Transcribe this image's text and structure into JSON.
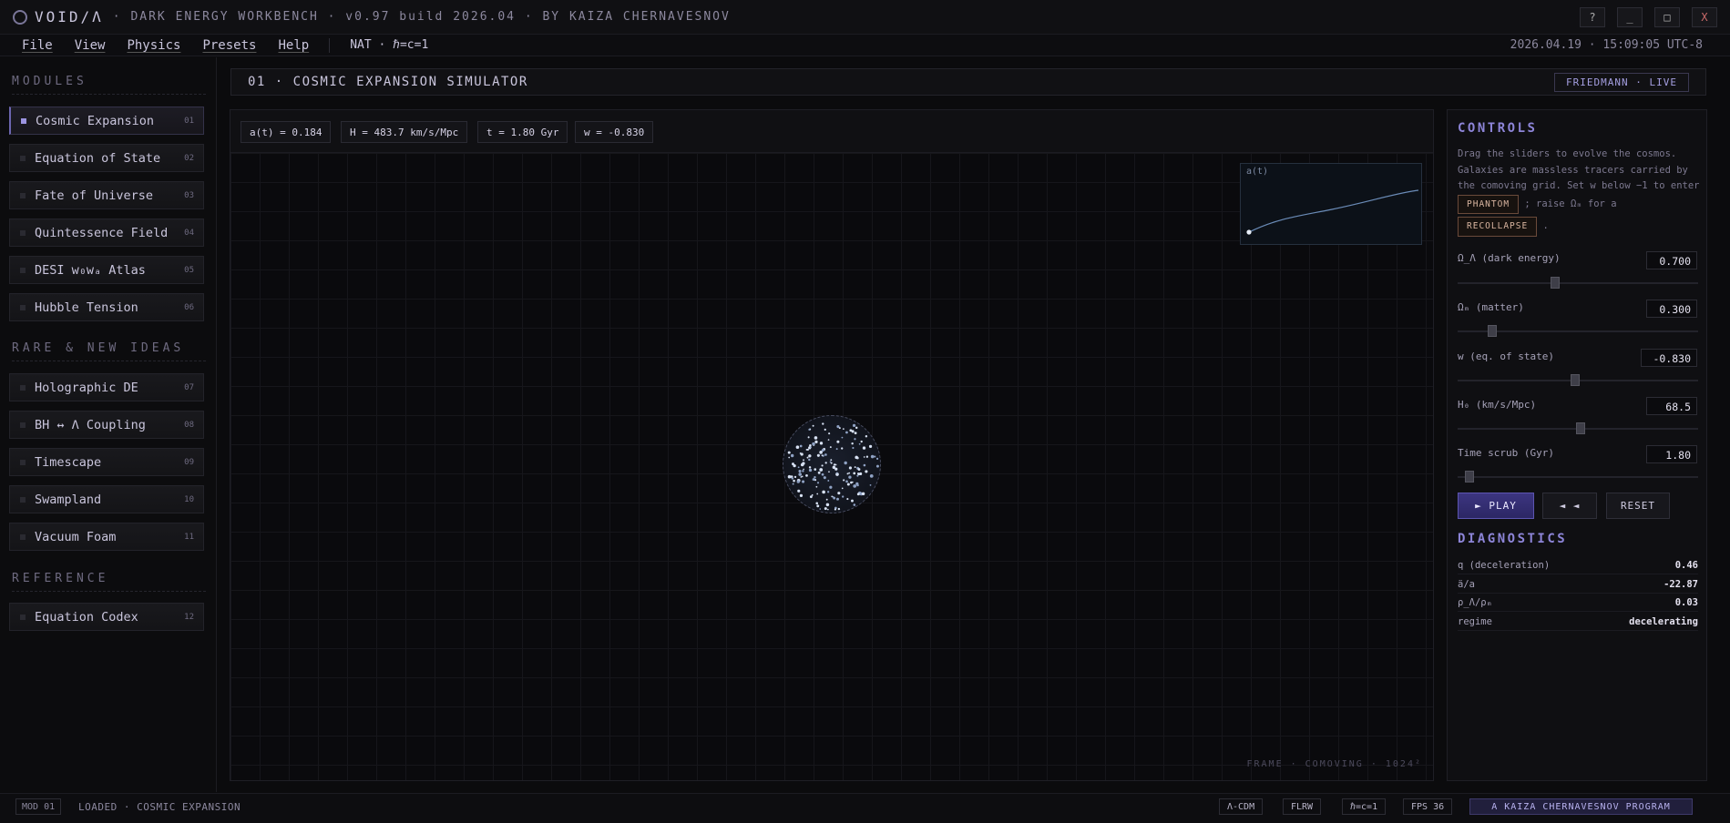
{
  "titlebar": {
    "app_name": "VOID/Λ",
    "subtitle": "· DARK ENERGY WORKBENCH · v0.97 build 2026.04 · BY KAIZA CHERNAVESNOV",
    "buttons": {
      "help": "?",
      "minimize": "_",
      "maximize": "□",
      "close": "X"
    }
  },
  "menubar": {
    "items": [
      "File",
      "View",
      "Physics",
      "Presets",
      "Help"
    ],
    "units": "NAT · ℏ=c=1",
    "clock": "2026.04.19 · 15:09:05 UTC-8"
  },
  "sidebar": {
    "sections": [
      {
        "title": "MODULES",
        "items": [
          {
            "label": "Cosmic Expansion",
            "num": "01",
            "active": true
          },
          {
            "label": "Equation of State",
            "num": "02"
          },
          {
            "label": "Fate of Universe",
            "num": "03"
          },
          {
            "label": "Quintessence Field",
            "num": "04"
          },
          {
            "label": "DESI w₀wₐ Atlas",
            "num": "05"
          },
          {
            "label": "Hubble Tension",
            "num": "06"
          }
        ]
      },
      {
        "title": "RARE & NEW IDEAS",
        "items": [
          {
            "label": "Holographic DE",
            "num": "07"
          },
          {
            "label": "BH ↔ Λ Coupling",
            "num": "08"
          },
          {
            "label": "Timescape",
            "num": "09"
          },
          {
            "label": "Swampland",
            "num": "10"
          },
          {
            "label": "Vacuum Foam",
            "num": "11"
          }
        ]
      },
      {
        "title": "REFERENCE",
        "items": [
          {
            "label": "Equation Codex",
            "num": "12"
          }
        ]
      }
    ]
  },
  "main": {
    "title": "01 · COSMIC EXPANSION SIMULATOR",
    "badge": "FRIEDMANN · LIVE",
    "readouts": {
      "a": "a(t) = 0.184",
      "H": "H = 483.7 km/s/Mpc",
      "t": "t = 1.80 Gyr",
      "w": "w = -0.830"
    },
    "minichart_label": "a(t)",
    "footer": "FRAME · COMOVING · 1024²"
  },
  "controls": {
    "title": "CONTROLS",
    "desc_1": "Drag the sliders to evolve the cosmos. Galaxies are massless tracers carried by the comoving grid. Set w below −1 to enter",
    "phantom_btn": "PHANTOM",
    "desc_2": "; raise Ωₘ for a",
    "recollapse_btn": "RECOLLAPSE",
    "desc_3": ".",
    "params": [
      {
        "label": "Ω_Λ (dark energy)",
        "value": "0.700",
        "fraction": 0.4
      },
      {
        "label": "Ωₘ (matter)",
        "value": "0.300",
        "fraction": 0.13
      },
      {
        "label": "w (eq. of state)",
        "value": "-0.830",
        "fraction": 0.49
      },
      {
        "label": "H₀ (km/s/Mpc)",
        "value": "68.5",
        "fraction": 0.51
      },
      {
        "label": "Time scrub (Gyr)",
        "value": "1.80",
        "fraction": 0.03
      }
    ],
    "play_btn": "► PLAY",
    "rewind_btn": "◄ ◄",
    "reset_btn": "RESET"
  },
  "diagnostics": {
    "title": "DIAGNOSTICS",
    "rows": [
      {
        "key": "q (deceleration)",
        "value": "0.46"
      },
      {
        "key": "ä/a",
        "value": "-22.87"
      },
      {
        "key": "ρ_Λ/ρₘ",
        "value": "0.03"
      },
      {
        "key": "regime",
        "value": "decelerating"
      }
    ]
  },
  "statusbar": {
    "module": "MOD 01",
    "message": "LOADED · COSMIC EXPANSION",
    "chips": [
      "Λ-CDM",
      "FLRW",
      "ℏ=c=1",
      "FPS 36"
    ],
    "credit": "A KAIZA CHERNAVESNOV PROGRAM"
  },
  "colors": {
    "accent": "#8d85d8",
    "background": "#0b0b0d",
    "phantom_border": "#6a4a3a"
  }
}
